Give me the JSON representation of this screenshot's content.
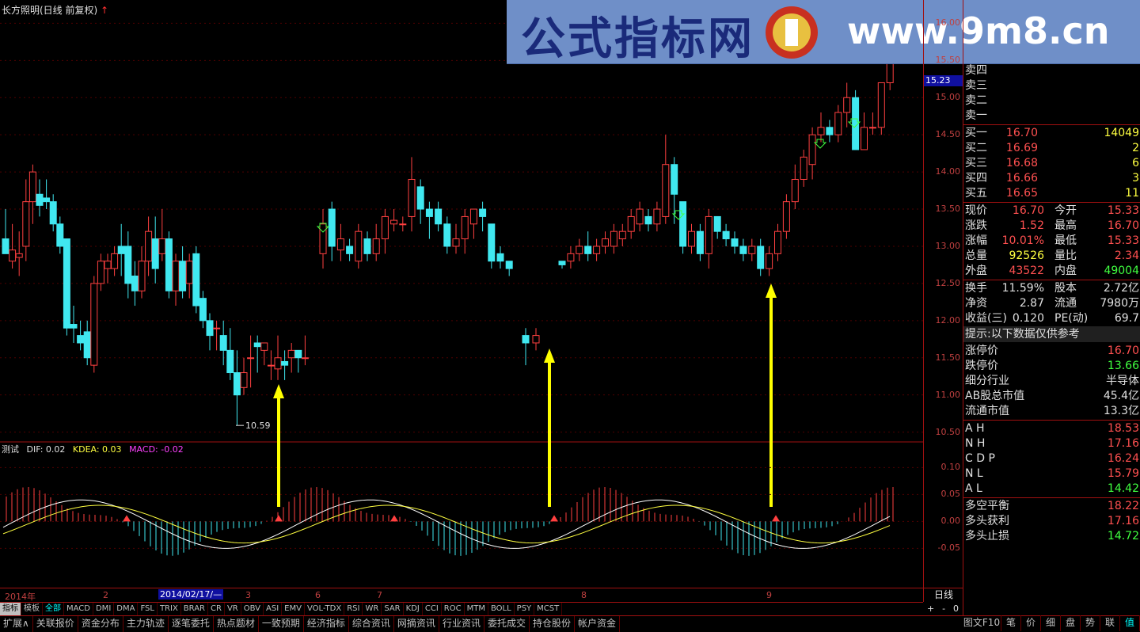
{
  "title": "长方照明(日线 前复权)",
  "indicator": {
    "name": "测试",
    "dif": "DIF: 0.02",
    "dea": "KDEA: 0.03",
    "macd": "MACD: -0.02"
  },
  "banner": {
    "cn": "公式指标网",
    "url": "www.9m8.cn"
  },
  "chart_data": {
    "type": "candlestick",
    "price_axis": [
      "16.00",
      "15.50",
      "15.00",
      "14.50",
      "14.00",
      "13.50",
      "13.00",
      "12.50",
      "12.00",
      "11.50",
      "11.00",
      "10.50"
    ],
    "ylim": [
      10.4,
      16.1
    ],
    "current_price_tag": "15.23",
    "low_label": "10.59",
    "macd_axis": [
      "0.10",
      "0.05",
      "0.00",
      "-0.05"
    ],
    "macd_ylim": [
      -0.12,
      0.13
    ],
    "candles": [
      [
        13.1,
        12.9,
        13.0,
        13.5
      ],
      [
        12.8,
        12.95,
        12.7,
        13.3
      ],
      [
        12.85,
        12.9,
        12.6,
        13.2
      ],
      [
        13.0,
        13.6,
        12.8,
        13.9
      ],
      [
        13.6,
        14.0,
        13.3,
        14.1
      ],
      [
        13.7,
        13.55,
        13.4,
        13.9
      ],
      [
        13.65,
        13.6,
        13.5,
        13.9
      ],
      [
        13.6,
        13.3,
        13.2,
        13.7
      ],
      [
        13.3,
        13.0,
        12.9,
        13.4
      ],
      [
        13.1,
        11.9,
        11.8,
        13.1
      ],
      [
        11.95,
        11.9,
        11.7,
        12.2
      ],
      [
        11.8,
        11.7,
        11.6,
        12.0
      ],
      [
        11.85,
        11.5,
        11.4,
        12.0
      ],
      [
        11.4,
        12.5,
        11.3,
        12.6
      ],
      [
        12.5,
        12.8,
        12.4,
        12.9
      ],
      [
        12.7,
        12.8,
        12.5,
        12.9
      ],
      [
        12.7,
        12.9,
        12.6,
        13.0
      ],
      [
        13.0,
        12.9,
        12.6,
        13.3
      ],
      [
        13.0,
        12.5,
        12.3,
        13.2
      ],
      [
        12.6,
        12.4,
        12.2,
        12.8
      ],
      [
        12.4,
        12.8,
        12.3,
        13.0
      ],
      [
        12.8,
        13.2,
        12.6,
        13.4
      ],
      [
        13.1,
        12.7,
        12.5,
        13.4
      ],
      [
        12.9,
        13.1,
        12.8,
        13.5
      ],
      [
        13.1,
        12.4,
        12.3,
        13.2
      ],
      [
        12.4,
        12.8,
        12.2,
        12.9
      ],
      [
        12.8,
        12.4,
        12.3,
        13.0
      ],
      [
        12.5,
        12.8,
        12.3,
        12.9
      ],
      [
        12.9,
        12.2,
        12.1,
        13.0
      ],
      [
        12.3,
        12.0,
        11.9,
        12.4
      ],
      [
        12.0,
        11.8,
        11.6,
        12.1
      ],
      [
        11.9,
        11.9,
        11.6,
        12.0
      ],
      [
        11.8,
        11.6,
        11.4,
        12.0
      ],
      [
        11.6,
        11.3,
        11.2,
        11.9
      ],
      [
        11.3,
        11.0,
        10.59,
        11.6
      ],
      [
        11.1,
        11.3,
        11.0,
        11.5
      ],
      [
        11.5,
        11.5,
        11.1,
        11.8
      ],
      [
        11.7,
        11.65,
        11.3,
        11.8
      ],
      [
        11.6,
        11.7,
        11.4,
        11.7
      ],
      [
        11.4,
        11.4,
        11.2,
        11.6
      ],
      [
        11.35,
        11.5,
        11.2,
        11.8
      ],
      [
        11.45,
        11.4,
        11.2,
        11.6
      ],
      [
        11.5,
        11.6,
        11.3,
        11.7
      ],
      [
        11.6,
        11.5,
        11.3,
        11.6
      ],
      [
        11.5,
        11.5,
        11.4,
        11.8
      ]
    ],
    "candles2": [
      [
        12.9,
        13.3,
        12.7,
        13.5
      ],
      [
        13.5,
        13.0,
        12.8,
        13.6
      ],
      [
        12.95,
        13.1,
        12.8,
        13.3
      ],
      [
        13.0,
        12.9,
        12.8,
        13.1
      ],
      [
        12.8,
        13.2,
        12.7,
        13.3
      ],
      [
        13.1,
        12.9,
        12.8,
        13.2
      ],
      [
        12.9,
        13.1,
        12.8,
        13.3
      ],
      [
        13.1,
        13.4,
        12.9,
        13.5
      ],
      [
        13.3,
        13.35,
        13.2,
        13.5
      ],
      [
        13.3,
        13.3,
        13.2,
        13.4
      ],
      [
        13.4,
        13.9,
        13.2,
        14.2
      ],
      [
        13.8,
        13.5,
        13.3,
        13.9
      ],
      [
        13.5,
        13.4,
        13.1,
        13.6
      ],
      [
        13.5,
        13.3,
        13.2,
        13.6
      ],
      [
        13.3,
        13.0,
        12.9,
        13.4
      ],
      [
        13.0,
        13.1,
        12.9,
        13.3
      ],
      [
        13.1,
        13.4,
        12.9,
        13.5
      ],
      [
        13.3,
        13.5,
        13.1,
        13.5
      ],
      [
        13.5,
        13.4,
        13.2,
        13.6
      ],
      [
        13.3,
        12.8,
        12.7,
        13.3
      ],
      [
        12.9,
        12.8,
        12.7,
        13.0
      ],
      [
        12.8,
        12.7,
        12.6,
        12.8
      ]
    ],
    "candles3": [
      [
        11.8,
        11.7,
        11.4,
        11.9
      ],
      [
        11.7,
        11.8,
        11.6,
        11.9
      ]
    ],
    "candles4": [
      [
        12.8,
        12.75,
        12.7,
        12.8
      ],
      [
        12.8,
        12.9,
        12.7,
        13.0
      ],
      [
        12.9,
        13.0,
        12.8,
        13.1
      ],
      [
        13.0,
        12.9,
        12.8,
        13.2
      ],
      [
        12.9,
        13.0,
        12.8,
        13.1
      ],
      [
        13.0,
        13.1,
        12.9,
        13.2
      ],
      [
        13.0,
        13.2,
        12.9,
        13.3
      ],
      [
        13.1,
        13.2,
        13.0,
        13.3
      ],
      [
        13.2,
        13.4,
        13.1,
        13.5
      ],
      [
        13.3,
        13.5,
        13.2,
        13.6
      ],
      [
        13.4,
        13.3,
        13.2,
        13.5
      ],
      [
        13.3,
        13.5,
        13.2,
        13.6
      ],
      [
        13.4,
        14.1,
        13.3,
        14.5
      ],
      [
        14.1,
        13.7,
        13.3,
        14.2
      ],
      [
        13.6,
        13.0,
        12.9,
        13.6
      ],
      [
        13.0,
        13.2,
        12.9,
        13.3
      ],
      [
        13.2,
        12.9,
        12.8,
        13.3
      ],
      [
        12.9,
        13.4,
        12.7,
        13.5
      ],
      [
        13.4,
        13.2,
        13.1,
        13.4
      ],
      [
        13.2,
        13.1,
        13.0,
        13.3
      ],
      [
        13.1,
        13.0,
        12.9,
        13.2
      ],
      [
        13.0,
        12.9,
        12.8,
        13.1
      ],
      [
        12.9,
        13.0,
        12.8,
        13.1
      ],
      [
        13.0,
        12.7,
        12.6,
        13.1
      ],
      [
        12.7,
        12.9,
        12.6,
        13.0
      ],
      [
        12.9,
        13.2,
        12.8,
        13.3
      ],
      [
        13.2,
        13.6,
        13.1,
        13.7
      ],
      [
        13.6,
        13.9,
        13.5,
        14.1
      ],
      [
        13.9,
        14.2,
        13.8,
        14.3
      ],
      [
        14.1,
        14.5,
        13.9,
        14.6
      ],
      [
        14.5,
        14.6,
        14.4,
        14.8
      ],
      [
        14.6,
        14.5,
        14.4,
        14.7
      ],
      [
        14.5,
        14.8,
        14.4,
        14.9
      ],
      [
        14.8,
        15.0,
        14.6,
        15.2
      ],
      [
        15.0,
        14.3,
        14.3,
        15.1
      ],
      [
        14.3,
        14.6,
        14.3,
        14.8
      ],
      [
        14.6,
        14.6,
        14.5,
        14.8
      ],
      [
        14.6,
        15.2,
        14.5,
        15.2
      ],
      [
        15.2,
        15.6,
        15.1,
        16.7
      ]
    ]
  },
  "right_panel": {
    "sell_labels": [
      "卖四",
      "卖三",
      "卖二",
      "卖一"
    ],
    "buy": [
      {
        "k": "买一",
        "p": "16.70",
        "v": "14049"
      },
      {
        "k": "买二",
        "p": "16.69",
        "v": "2"
      },
      {
        "k": "买三",
        "p": "16.68",
        "v": "6"
      },
      {
        "k": "买四",
        "p": "16.66",
        "v": "3"
      },
      {
        "k": "买五",
        "p": "16.65",
        "v": "11"
      }
    ],
    "quote": [
      {
        "k": "现价",
        "a": "16.70",
        "k2": "今开",
        "b": "15.33",
        "ca": "#ff5050",
        "cb": "#ff5050"
      },
      {
        "k": "涨跌",
        "a": "1.52",
        "k2": "最高",
        "b": "16.70",
        "ca": "#ff5050",
        "cb": "#ff5050"
      },
      {
        "k": "涨幅",
        "a": "10.01%",
        "k2": "最低",
        "b": "15.33",
        "ca": "#ff5050",
        "cb": "#ff5050"
      },
      {
        "k": "总量",
        "a": "92526",
        "k2": "量比",
        "b": "2.34",
        "ca": "#ffff40",
        "cb": "#ff5050"
      },
      {
        "k": "外盘",
        "a": "43522",
        "k2": "内盘",
        "b": "49004",
        "ca": "#ff5050",
        "cb": "#40ff40"
      }
    ],
    "stats": [
      {
        "k": "换手",
        "a": "11.59%",
        "k2": "股本",
        "b": "2.72亿",
        "ca": "#e0e0e0",
        "cb": "#e0e0e0"
      },
      {
        "k": "净资",
        "a": "2.87",
        "k2": "流通",
        "b": "7980万",
        "ca": "#e0e0e0",
        "cb": "#e0e0e0"
      },
      {
        "k": "收益(三)",
        "a": "0.120",
        "k2": "PE(动)",
        "b": "69.7",
        "ca": "#e0e0e0",
        "cb": "#e0e0e0"
      }
    ],
    "hint": "提示:以下数据仅供参考",
    "info": [
      {
        "k": "涨停价",
        "v": "16.70",
        "c": "#ff5050"
      },
      {
        "k": "跌停价",
        "v": "13.66",
        "c": "#40ff40"
      },
      {
        "k": "细分行业",
        "v": "半导体",
        "c": "#e0e0e0"
      },
      {
        "k": "AB股总市值",
        "v": "45.4亿",
        "c": "#e0e0e0"
      },
      {
        "k": "流通市值",
        "v": "13.3亿",
        "c": "#e0e0e0"
      }
    ],
    "levels": [
      {
        "k": "A H",
        "v": "18.53"
      },
      {
        "k": "N H",
        "v": "17.16"
      },
      {
        "k": "C D P",
        "v": "16.24"
      },
      {
        "k": "N L",
        "v": "15.79"
      },
      {
        "k": "A L",
        "v": "14.42",
        "c": "#40ff40"
      }
    ],
    "balance": [
      {
        "k": "多空平衡",
        "v": "18.22"
      },
      {
        "k": "多头获利",
        "v": "17.16"
      },
      {
        "k": "多头止损",
        "v": "14.72",
        "c": "#40ff40"
      }
    ]
  },
  "dates": {
    "year": "2014年",
    "m2": "2",
    "cursor": "2014/02/17/—",
    "m3": "3",
    "m6": "6",
    "m7": "7",
    "m8": "8",
    "m9": "9"
  },
  "period": "日线",
  "indicator_tabs": [
    "指标",
    "模板",
    "全部",
    "MACD",
    "DMI",
    "DMA",
    "FSL",
    "TRIX",
    "BRAR",
    "CR",
    "VR",
    "OBV",
    "ASI",
    "EMV",
    "VOL-TDX",
    "RSI",
    "WR",
    "SAR",
    "KDJ",
    "CCI",
    "ROC",
    "MTM",
    "BOLL",
    "PSY",
    "MCST"
  ],
  "bottom_tabs": [
    "扩展∧",
    "关联报价",
    "资金分布",
    "主力轨迹",
    "逐笔委托",
    "热点题材",
    "一致预期",
    "经济指标",
    "综合资讯",
    "网摘资讯",
    "行业资讯",
    "委托成交",
    "持仓股份",
    "帐户资金"
  ],
  "ctrl": {
    "plus": "+",
    "minus": "-",
    "zero": "0",
    "fig": "图文F10"
  },
  "side_tabs": [
    "笔",
    "价",
    "细",
    "盘",
    "势",
    "联",
    "值"
  ]
}
